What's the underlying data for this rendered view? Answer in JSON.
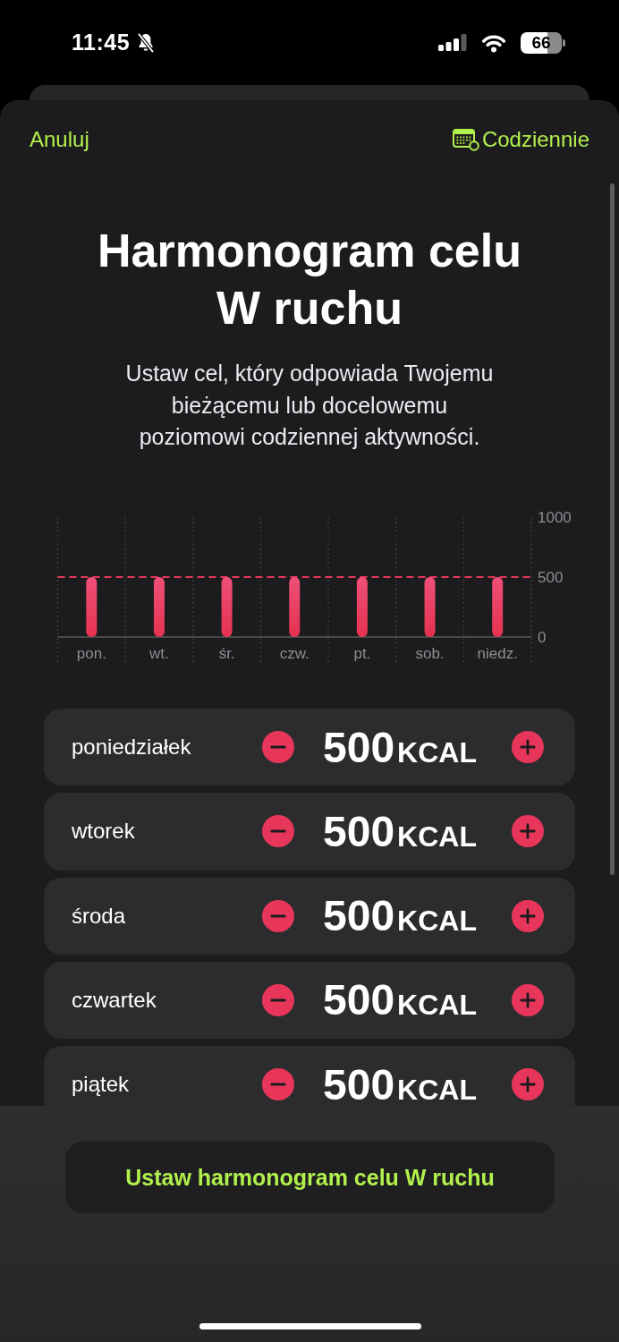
{
  "status_bar": {
    "time": "11:45",
    "battery": "66"
  },
  "header": {
    "cancel": "Anuluj",
    "frequency": "Codziennie"
  },
  "title": "Harmonogram celu W ruchu",
  "subtitle": "Ustaw cel, który odpowiada Twojemu bieżącemu lub docelowemu poziomowi codziennej aktywności.",
  "chart": {
    "chart_data": {
      "type": "bar",
      "categories": [
        "pon.",
        "wt.",
        "śr.",
        "czw.",
        "pt.",
        "sob.",
        "niedz."
      ],
      "values": [
        500,
        500,
        500,
        500,
        500,
        500,
        500
      ],
      "ylim": [
        0,
        1000
      ],
      "yticks": [
        0,
        500,
        1000
      ],
      "ref_lines": [
        {
          "axis": "y",
          "value": 500
        }
      ]
    }
  },
  "days": [
    {
      "name": "poniedziałek",
      "value": "500",
      "unit": "KCAL"
    },
    {
      "name": "wtorek",
      "value": "500",
      "unit": "KCAL"
    },
    {
      "name": "środa",
      "value": "500",
      "unit": "KCAL"
    },
    {
      "name": "czwartek",
      "value": "500",
      "unit": "KCAL"
    },
    {
      "name": "piątek",
      "value": "500",
      "unit": "KCAL"
    }
  ],
  "primary_button": "Ustaw harmonogram celu W ruchu"
}
